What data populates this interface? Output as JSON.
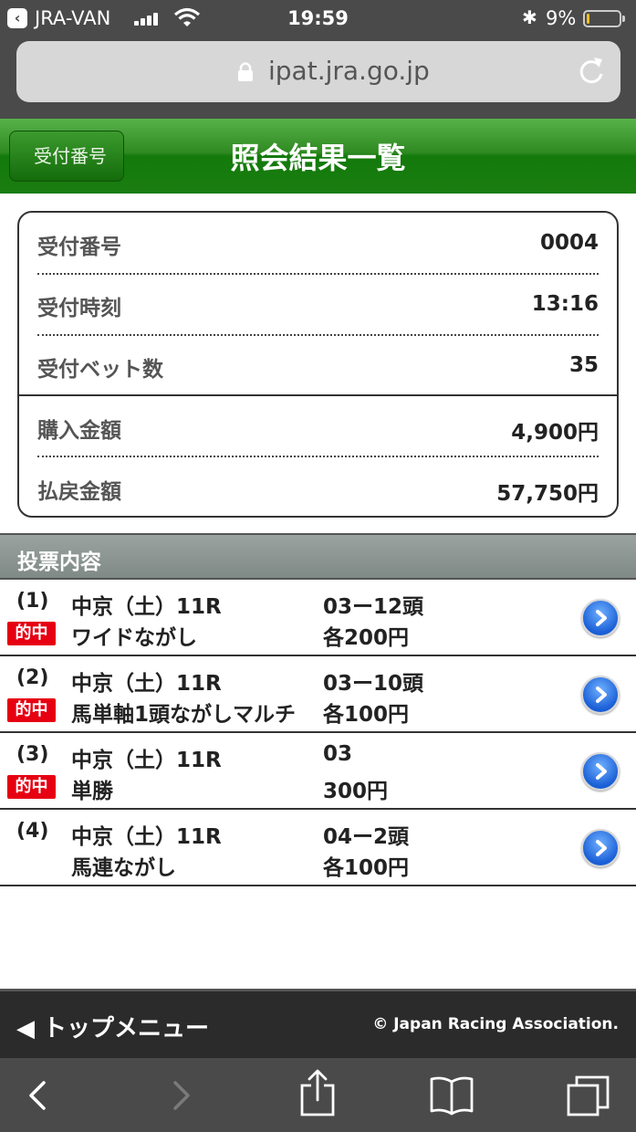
{
  "status_bar": {
    "carrier": "JRA-VAN",
    "time": "19:59",
    "battery_pct": "9%",
    "battery_level": 0.09,
    "battery_color": "#f2c01e"
  },
  "address_bar": {
    "url": "ipat.jra.go.jp"
  },
  "header": {
    "back_label": "受付番号",
    "title": "照会結果一覧",
    "color": "#1a7d10"
  },
  "summary": {
    "rows": [
      {
        "label": "受付番号",
        "value": "0004"
      },
      {
        "label": "受付時刻",
        "value": "13:16"
      },
      {
        "label": "受付ベット数",
        "value": "35"
      },
      {
        "label": "購入金額",
        "value": "4,900円"
      },
      {
        "label": "払戻金額",
        "value": "57,750円"
      }
    ]
  },
  "section": {
    "label": "投票内容"
  },
  "bets": [
    {
      "num": "(1)",
      "hit": "的中",
      "race": "中京（土）11R",
      "type": "ワイドながし",
      "combo": "03ー12頭",
      "amount": "各200円"
    },
    {
      "num": "(2)",
      "hit": "的中",
      "race": "中京（土）11R",
      "type": "馬単軸1頭ながしマルチ",
      "combo": "03ー10頭",
      "amount": "各100円"
    },
    {
      "num": "(3)",
      "hit": "的中",
      "race": "中京（土）11R",
      "type": "単勝",
      "combo": "03",
      "amount": "300円"
    },
    {
      "num": "(4)",
      "hit": "",
      "race": "中京（土）11R",
      "type": "馬連ながし",
      "combo": "04ー2頭",
      "amount": "各100円"
    }
  ],
  "footer": {
    "top_menu": "◀ トップメニュー",
    "copyright": "© Japan Racing Association."
  },
  "toolbar": {
    "icons": [
      "back-icon",
      "forward-icon",
      "share-icon",
      "bookmarks-icon",
      "tabs-icon"
    ]
  }
}
